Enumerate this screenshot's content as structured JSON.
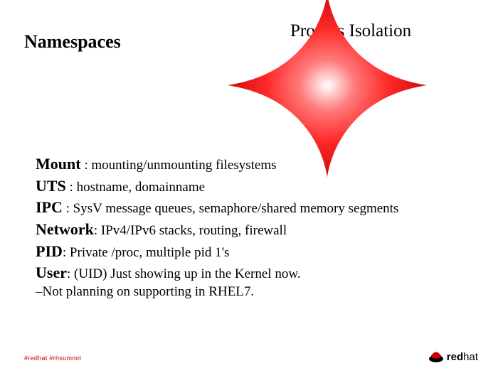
{
  "title_left": "Namespaces",
  "title_right": "Process Isolation",
  "items": [
    {
      "term": "Mount",
      "sep": " : ",
      "desc": "mounting/unmounting filesystems"
    },
    {
      "term": "UTS",
      "sep": " : ",
      "desc": "hostname, domainname"
    },
    {
      "term": "IPC",
      "sep": " : ",
      "desc": "SysV message queues, semaphore/shared memory segments"
    },
    {
      "term": "Network",
      "sep": ": ",
      "desc": "IPv4/IPv6 stacks, routing, firewall"
    },
    {
      "term": "PID",
      "sep": ":  ",
      "desc": "Private /proc, multiple pid 1's"
    },
    {
      "term": "User",
      "sep": ": ",
      "desc": "(UID) Just showing up in the Kernel now."
    }
  ],
  "note": "–Not planning on supporting in RHEL7.",
  "footer": {
    "hashtags": "#redhat  #rhsummit",
    "brand_bold": "red",
    "brand_rest": "hat"
  },
  "colors": {
    "accent": "#cc0000",
    "star0": "#ff2a2a",
    "star1": "#c40000"
  }
}
